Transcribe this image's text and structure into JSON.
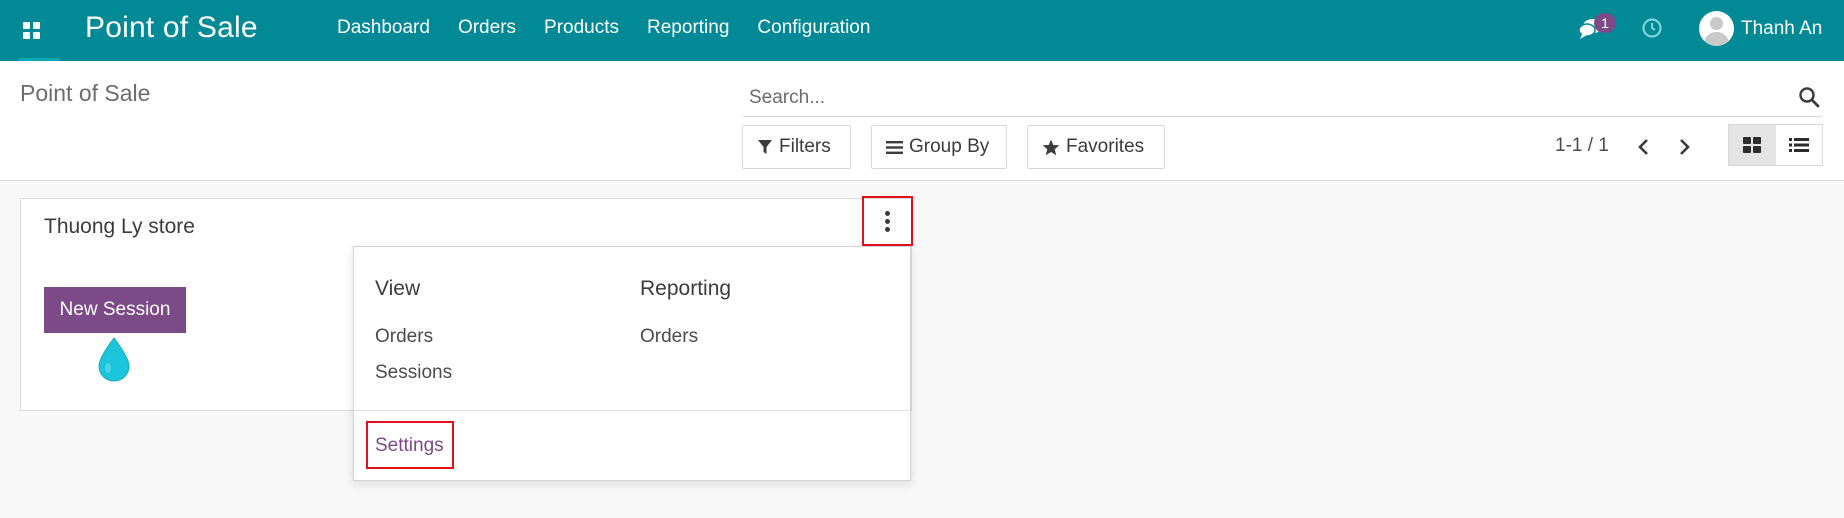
{
  "navbar": {
    "app_title": "Point of Sale",
    "menu": [
      "Dashboard",
      "Orders",
      "Products",
      "Reporting",
      "Configuration"
    ],
    "chat_badge": "1",
    "user_name": "Thanh An",
    "bg_color": "#018a96"
  },
  "control_panel": {
    "breadcrumb": "Point of Sale",
    "search_placeholder": "Search...",
    "filters_label": "Filters",
    "groupby_label": "Group By",
    "favorites_label": "Favorites",
    "pager": "1-1 / 1",
    "view_mode": "kanban"
  },
  "card": {
    "title": "Thuong Ly store",
    "new_session_label": "New Session",
    "accent_color": "#7c4a86"
  },
  "dropdown": {
    "view_heading": "View",
    "view_items": [
      "Orders",
      "Sessions"
    ],
    "reporting_heading": "Reporting",
    "reporting_items": [
      "Orders"
    ],
    "settings_label": "Settings"
  }
}
